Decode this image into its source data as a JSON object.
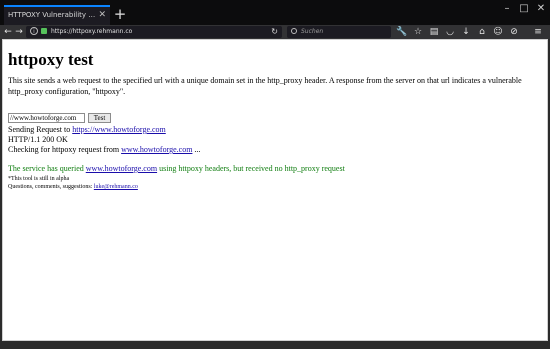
{
  "browser": {
    "tab_title": "HTTPOXY Vulnerability Checki...",
    "url": "https://httpoxy.rehmann.co",
    "search_placeholder": "Suchen",
    "icons": {
      "tab_close": "close-icon",
      "new_tab": "plus-icon",
      "back": "back-arrow-icon",
      "forward": "forward-arrow-icon",
      "reload": "reload-icon",
      "info": "info-icon",
      "lock": "lock-icon",
      "search": "search-icon",
      "toolbar": [
        "wrench-icon",
        "star-icon",
        "clipboard-icon",
        "pocket-icon",
        "download-icon",
        "home-icon",
        "smiley-icon",
        "extension-icon",
        "menu-icon"
      ]
    }
  },
  "page": {
    "title": "httpoxy test",
    "intro": "This site sends a web request to the specified url with a unique domain set in the http_proxy header. A response from the server on that url indicates a vulnerable http_proxy configuration, \"httpoxy\".",
    "form": {
      "url_value": "//www.howtoforge.com",
      "button_label": "Test"
    },
    "log": {
      "sending_prefix": "Sending Request to",
      "sending_link": "https://www.howtoforge.com",
      "status": "HTTP/1.1 200 OK",
      "checking_prefix": "Checking for httpoxy request from",
      "checking_link": "www.howtoforge.com",
      "checking_suffix": "..."
    },
    "result": {
      "prefix": "The service has queried",
      "link": "www.howtoforge.com",
      "suffix": "using httpoxy headers, but received no http_proxy request"
    },
    "footer": {
      "alpha_note": "*This tool is still in alpha",
      "contact_prefix": "Questions, comments, suggestions:",
      "contact_link": "luke@rehmann.co"
    }
  },
  "colors": {
    "tab_accent": "#0a84ff",
    "link": "#1a0dab",
    "result_text": "#0f7d0f",
    "lock": "#56c25b"
  }
}
